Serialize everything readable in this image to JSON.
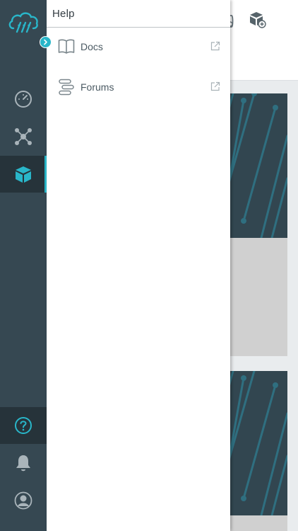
{
  "drawer": {
    "title": "Help",
    "items": [
      {
        "label": "Docs",
        "icon": "book-icon"
      },
      {
        "label": "Forums",
        "icon": "forum-icon"
      }
    ]
  },
  "rail": {
    "items": [
      "dashboard-icon",
      "network-icon",
      "cube-icon",
      "help-icon",
      "bell-icon",
      "user-icon"
    ],
    "active": "cube-icon"
  },
  "colors": {
    "rail": "#364852",
    "rail_active": "#26333a",
    "accent": "#29b6c9",
    "drawer_bg": "#ffffff",
    "banner": "#324650"
  }
}
